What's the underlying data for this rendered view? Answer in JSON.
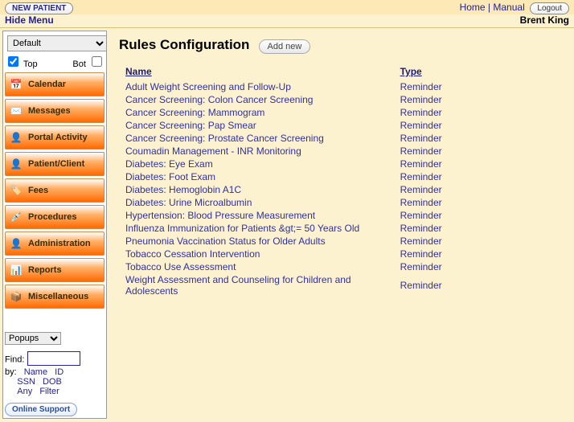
{
  "topbar": {
    "new_patient": "NEW PATIENT",
    "home": "Home",
    "manual": "Manual",
    "logout": "Logout"
  },
  "secondbar": {
    "hide_menu": "Hide Menu",
    "username": "Brent King"
  },
  "sidebar": {
    "view_select": "Default",
    "top_label": "Top",
    "bot_label": "Bot",
    "nav": [
      "Calendar",
      "Messages",
      "Portal Activity",
      "Patient/Client",
      "Fees",
      "Procedures",
      "Administration",
      "Reports",
      "Miscellaneous"
    ],
    "popups_select": "Popups",
    "find_label": "Find:",
    "by_label": "by:",
    "search": {
      "name": "Name",
      "id": "ID",
      "ssn": "SSN",
      "dob": "DOB",
      "any": "Any",
      "filter": "Filter"
    },
    "support": "Online Support"
  },
  "main": {
    "title": "Rules Configuration",
    "add_new": "Add new",
    "col_name": "Name",
    "col_type": "Type",
    "rules": [
      {
        "name": "Adult Weight Screening and Follow-Up",
        "type": "Reminder"
      },
      {
        "name": "Cancer Screening: Colon Cancer Screening",
        "type": "Reminder"
      },
      {
        "name": "Cancer Screening: Mammogram",
        "type": "Reminder"
      },
      {
        "name": "Cancer Screening: Pap Smear",
        "type": "Reminder"
      },
      {
        "name": "Cancer Screening: Prostate Cancer Screening",
        "type": "Reminder"
      },
      {
        "name": "Coumadin Management - INR Monitoring",
        "type": "Reminder"
      },
      {
        "name": "Diabetes: Eye Exam",
        "type": "Reminder"
      },
      {
        "name": "Diabetes: Foot Exam",
        "type": "Reminder"
      },
      {
        "name": "Diabetes: Hemoglobin A1C",
        "type": "Reminder"
      },
      {
        "name": "Diabetes: Urine Microalbumin",
        "type": "Reminder"
      },
      {
        "name": "Hypertension: Blood Pressure Measurement",
        "type": "Reminder"
      },
      {
        "name": "Influenza Immunization for Patients &gt;= 50 Years Old",
        "type": "Reminder"
      },
      {
        "name": "Pneumonia Vaccination Status for Older Adults",
        "type": "Reminder"
      },
      {
        "name": "Tobacco Cessation Intervention",
        "type": "Reminder"
      },
      {
        "name": "Tobacco Use Assessment",
        "type": "Reminder"
      },
      {
        "name": "Weight Assessment and Counseling for Children and Adolescents",
        "type": "Reminder"
      }
    ]
  },
  "icons": [
    "📅",
    "✉️",
    "👤",
    "👤",
    "🏷️",
    "💉",
    "👤",
    "📊",
    "📦"
  ]
}
